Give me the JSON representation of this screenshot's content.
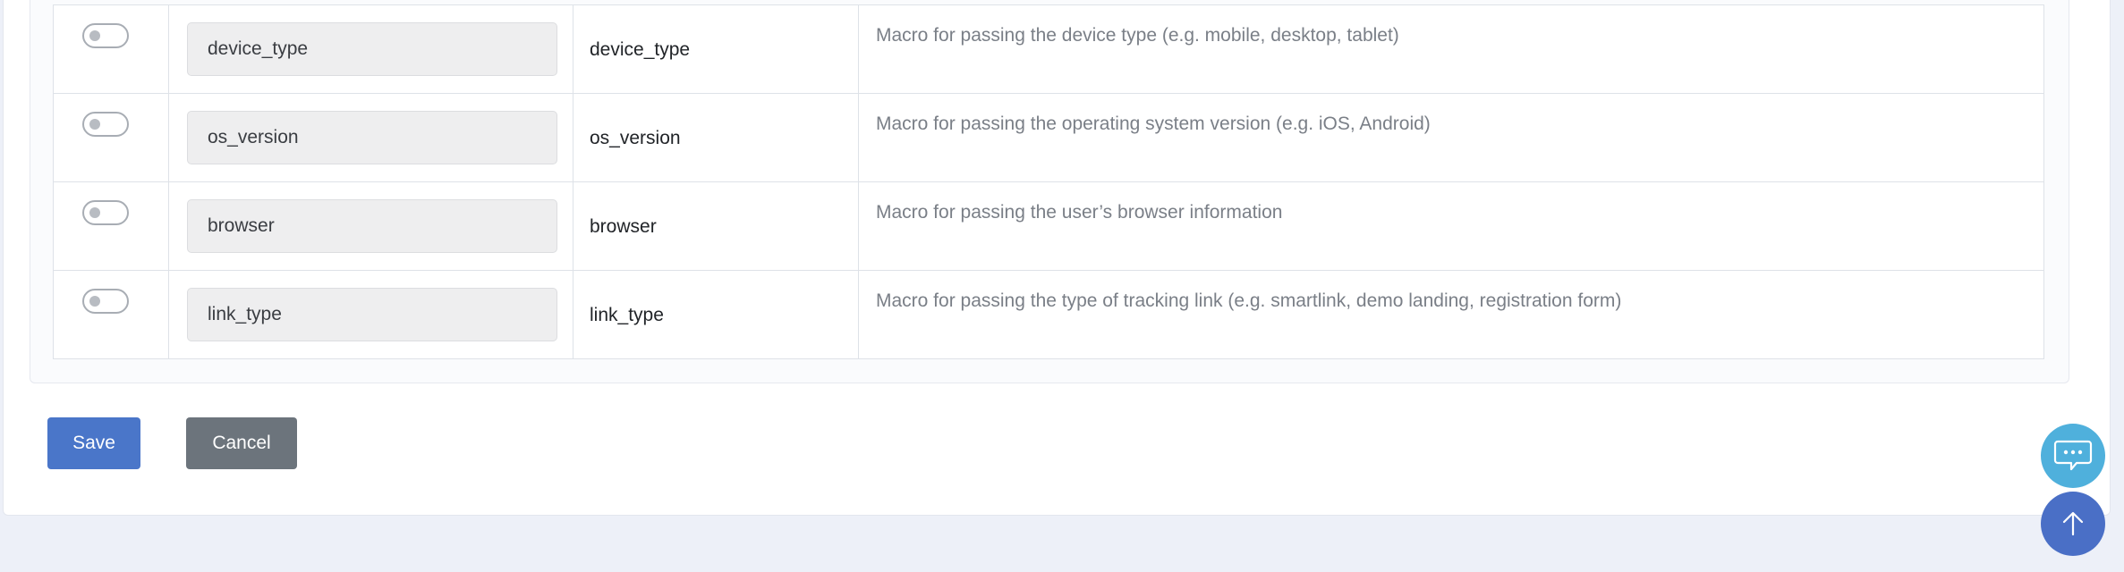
{
  "rows": [
    {
      "name_value": "device_type",
      "macro": "device_type",
      "description": "Macro for passing the device type (e.g. mobile, desktop, tablet)",
      "enabled": false
    },
    {
      "name_value": "os_version",
      "macro": "os_version",
      "description": "Macro for passing the operating system version (e.g. iOS, Android)",
      "enabled": false
    },
    {
      "name_value": "browser",
      "macro": "browser",
      "description": "Macro for passing the user’s browser information",
      "enabled": false
    },
    {
      "name_value": "link_type",
      "macro": "link_type",
      "description": "Macro for passing the type of tracking link (e.g. smartlink, demo landing, registration form)",
      "enabled": false
    }
  ],
  "actions": {
    "save_label": "Save",
    "cancel_label": "Cancel"
  },
  "floating": {
    "chat_icon": "chat-bubble-icon",
    "scroll_top_icon": "arrow-up-icon"
  },
  "colors": {
    "save": "#4a76c9",
    "cancel": "#6c747c",
    "chat_fab": "#4fb0dc",
    "scroll_fab": "#4a6fc6",
    "page_bg": "#edf0f8"
  }
}
